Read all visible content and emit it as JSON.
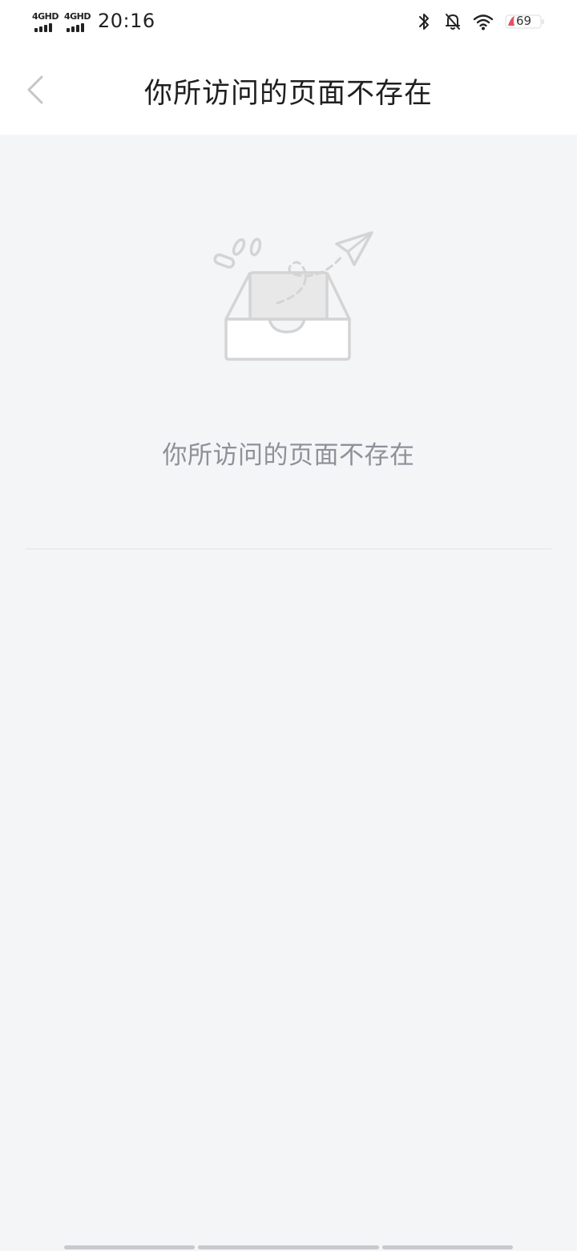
{
  "status_bar": {
    "network_1": "4GHD",
    "network_2": "4GHD",
    "time": "20:16",
    "battery_level": "69",
    "icons": [
      "bluetooth-icon",
      "bell-off-icon",
      "wifi-icon",
      "battery-icon"
    ]
  },
  "header": {
    "back_icon": "chevron-left-icon",
    "title": "你所访问的页面不存在"
  },
  "empty_state": {
    "illustration": "empty-inbox-paper-plane-illustration",
    "message": "你所访问的页面不存在"
  },
  "colors": {
    "header_background": "#ffffff",
    "page_background": "#f4f5f7",
    "title_text": "#1f1f1f",
    "message_text": "#8d9199",
    "illustration_stroke": "#d4d4d4"
  }
}
